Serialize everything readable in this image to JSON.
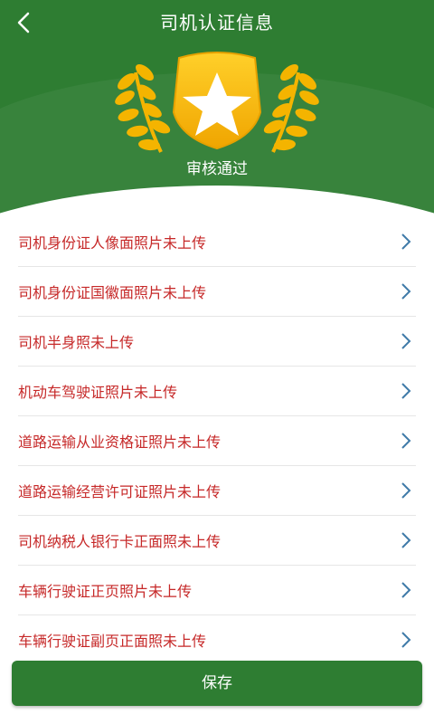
{
  "header": {
    "title": "司机认证信息",
    "status": "审核通过"
  },
  "items": [
    {
      "label": "司机身份证人像面照片未上传"
    },
    {
      "label": "司机身份证国徽面照片未上传"
    },
    {
      "label": "司机半身照未上传"
    },
    {
      "label": "机动车驾驶证照片未上传"
    },
    {
      "label": "道路运输从业资格证照片未上传"
    },
    {
      "label": "道路运输经营许可证照片未上传"
    },
    {
      "label": "司机纳税人银行卡正面照未上传"
    },
    {
      "label": "车辆行驶证正页照片未上传"
    },
    {
      "label": "车辆行驶证副页正面照未上传"
    }
  ],
  "footer": {
    "save_label": "保存"
  },
  "colors": {
    "primary": "#2e7d32",
    "warning_text": "#c62828",
    "badge_gold": "#f9b800"
  },
  "icons": {
    "back": "chevron-left-icon",
    "badge": "star-shield-icon",
    "row_arrow": "chevron-right-icon"
  }
}
